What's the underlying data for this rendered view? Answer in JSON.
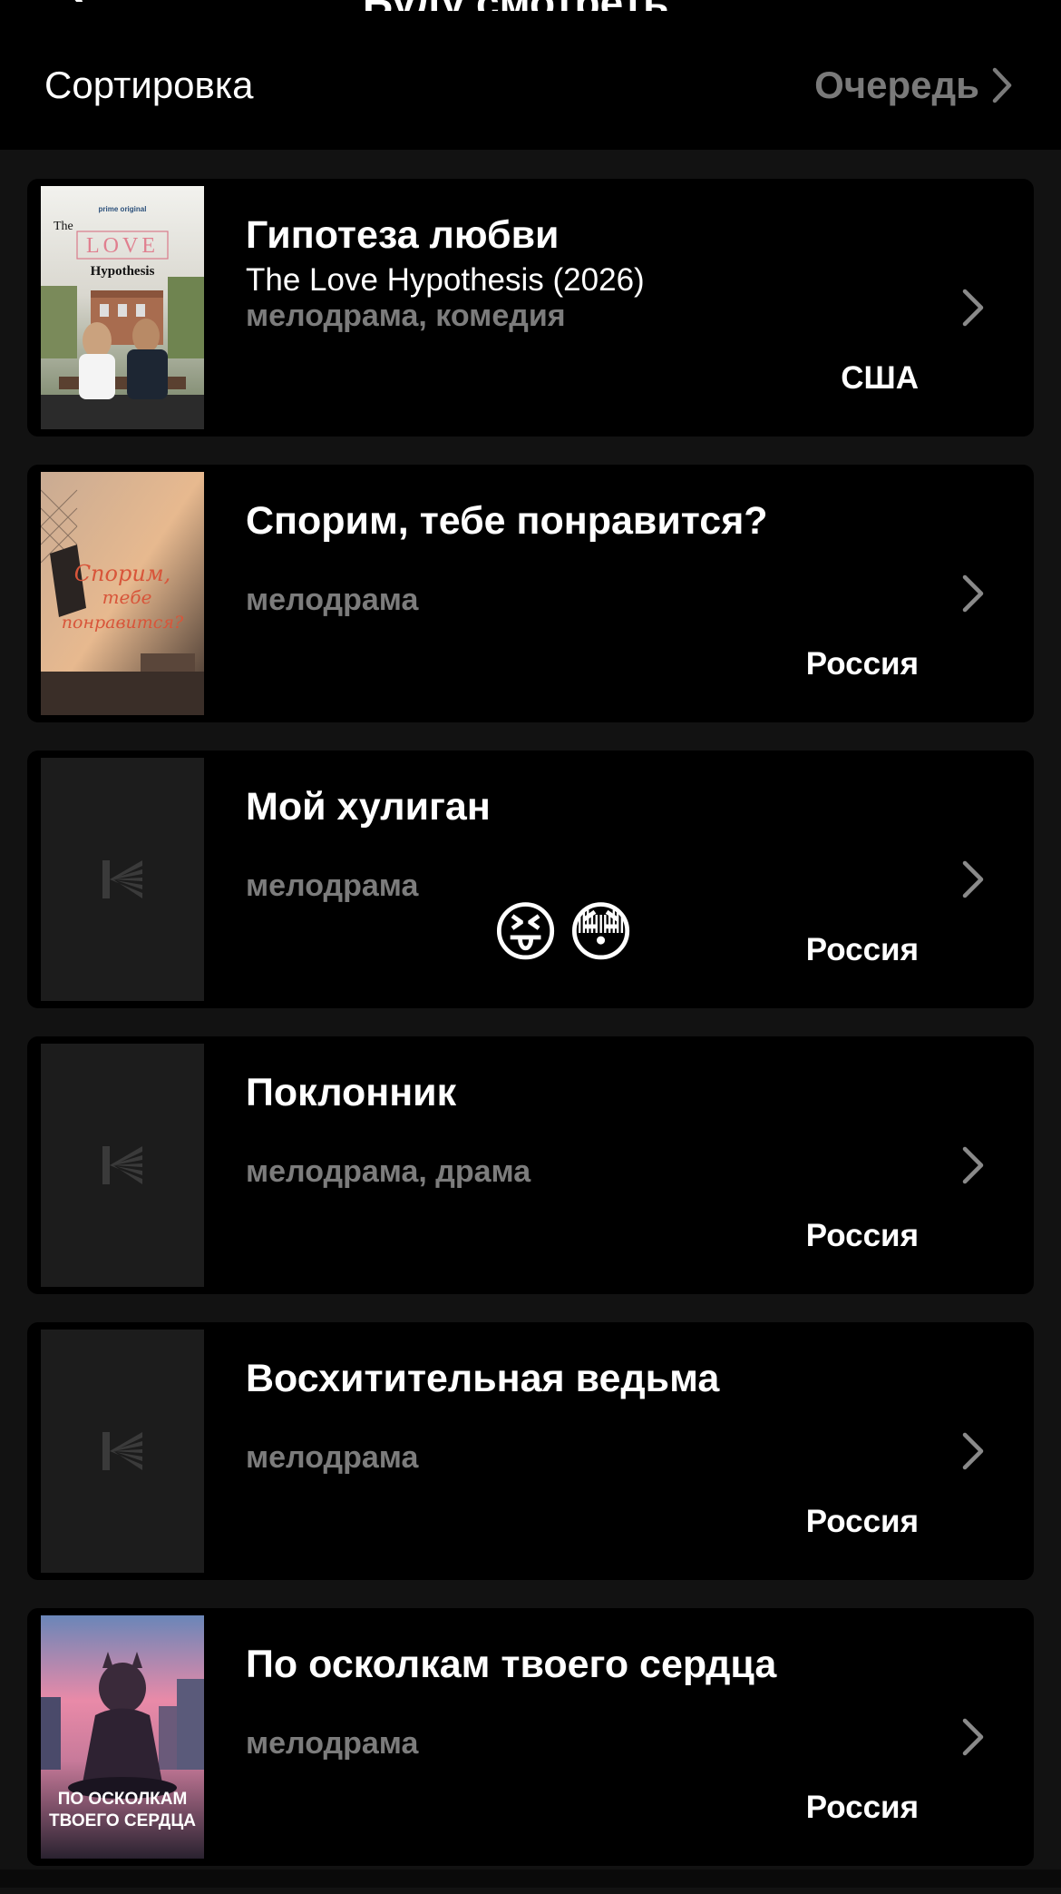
{
  "header": {
    "cut_title": "Буду смотреть",
    "sort_label": "Сортировка",
    "queue_label": "Очередь"
  },
  "movies": [
    {
      "title": "Гипотеза любви",
      "original_title": "The Love Hypothesis (2026)",
      "genres": "мелодрама, комедия",
      "country": "США",
      "poster": "the-love-hypothesis-poster",
      "poster_text": [
        "prime original",
        "The",
        "LOVE",
        "Hypothesis"
      ]
    },
    {
      "title": "Спорим, тебе понравится?",
      "genres": "мелодрама",
      "country": "Россия",
      "poster": "sporim-poster",
      "poster_text": [
        "Спорим,",
        "тебе",
        "понравится?"
      ]
    },
    {
      "title": "Мой хулиган",
      "genres": "мелодрама",
      "country": "Россия",
      "poster": "placeholder",
      "emojis": [
        "😝",
        "😳"
      ]
    },
    {
      "title": "Поклонник",
      "genres": "мелодрама, драма",
      "country": "Россия",
      "poster": "placeholder"
    },
    {
      "title": "Восхитительная ведьма",
      "genres": "мелодрама",
      "country": "Россия",
      "poster": "placeholder"
    },
    {
      "title": "По осколкам твоего сердца",
      "genres": "мелодрама",
      "country": "Россия",
      "poster": "po-oskolkam-poster",
      "poster_text": [
        "ПО ОСКОЛКАМ",
        "ТВОЕГО СЕРДЦА"
      ]
    }
  ],
  "colors": {
    "background": "#121212",
    "card": "#000000",
    "muted_text": "#7c7c7c",
    "placeholder_bg": "#1c1c1c"
  }
}
